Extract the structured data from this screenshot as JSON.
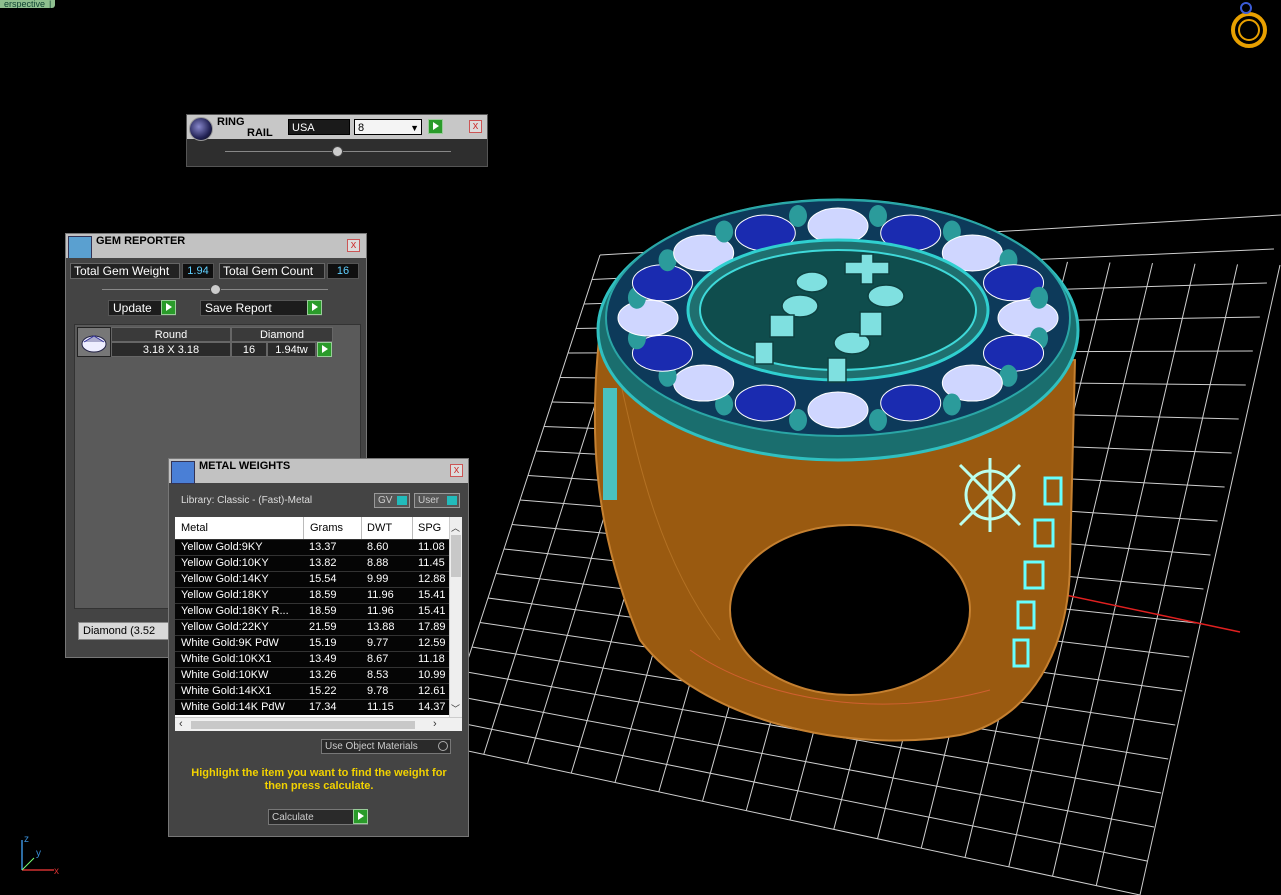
{
  "viewport": {
    "tab_label": "erspective",
    "tab_pipe": "|"
  },
  "ring_rail": {
    "title_line1": "RING",
    "title_line2": "RAIL",
    "standard": "USA",
    "size": "8",
    "close": "x"
  },
  "gem_reporter": {
    "title": "GEM REPORTER",
    "close": "x",
    "total_weight_label": "Total Gem Weight",
    "total_weight_value": "1.94",
    "total_count_label": "Total Gem Count",
    "total_count_value": "16",
    "update_label": "Update",
    "save_report_label": "Save Report",
    "table_headers": [
      "Round",
      "Diamond"
    ],
    "row": {
      "size": "3.18 X 3.18",
      "count": "16",
      "weight": "1.94tw"
    },
    "footer": "Diamond (3.52"
  },
  "metal_weights": {
    "title": "METAL WEIGHTS",
    "close": "x",
    "library": "Library: Classic - (Fast)-Metal",
    "toggle_gv": "GV",
    "toggle_user": "User",
    "columns": [
      "Metal",
      "Grams",
      "DWT",
      "SPG"
    ],
    "rows": [
      [
        "Yellow Gold:9KY",
        "13.37",
        "8.60",
        "11.08"
      ],
      [
        "Yellow Gold:10KY",
        "13.82",
        "8.88",
        "11.45"
      ],
      [
        "Yellow Gold:14KY",
        "15.54",
        "9.99",
        "12.88"
      ],
      [
        "Yellow Gold:18KY",
        "18.59",
        "11.96",
        "15.41"
      ],
      [
        "Yellow Gold:18KY R...",
        "18.59",
        "11.96",
        "15.41"
      ],
      [
        "Yellow Gold:22KY",
        "21.59",
        "13.88",
        "17.89"
      ],
      [
        "White Gold:9K PdW",
        "15.19",
        "9.77",
        "12.59"
      ],
      [
        "White Gold:10KX1",
        "13.49",
        "8.67",
        "11.18"
      ],
      [
        "White Gold:10KW",
        "13.26",
        "8.53",
        "10.99"
      ],
      [
        "White Gold:14KX1",
        "15.22",
        "9.78",
        "12.61"
      ],
      [
        "White Gold:14K PdW",
        "17.34",
        "11.15",
        "14.37"
      ]
    ],
    "use_object_materials": "Use Object Materials",
    "hint": "Highlight the item you want to find the weight for then press calculate.",
    "calculate_label": "Calculate"
  },
  "axis": {
    "z": "z",
    "y": "y",
    "x": "x"
  },
  "colors": {
    "grid": "#cfcfcf",
    "metal": "#b06a10",
    "teal": "#2aa6a6",
    "blue": "#1a2bb0",
    "hint": "#f2d200"
  }
}
